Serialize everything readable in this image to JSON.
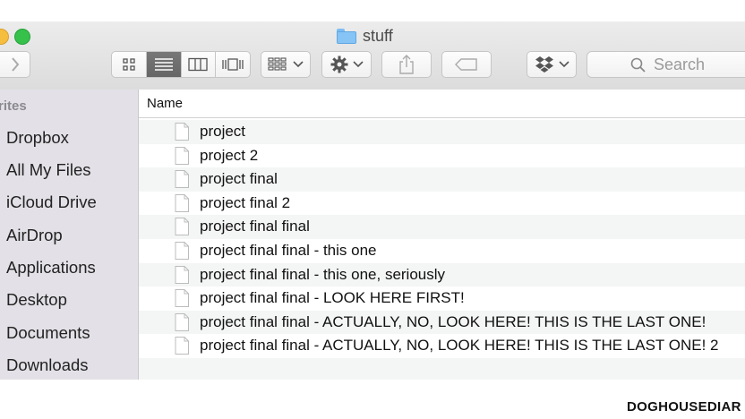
{
  "window": {
    "title": "stuff"
  },
  "toolbar": {
    "search_placeholder": "Search"
  },
  "sidebar": {
    "header": "rites",
    "items": [
      {
        "label": "Dropbox"
      },
      {
        "label": "All My Files"
      },
      {
        "label": "iCloud Drive"
      },
      {
        "label": "AirDrop"
      },
      {
        "label": "Applications"
      },
      {
        "label": "Desktop"
      },
      {
        "label": "Documents"
      },
      {
        "label": "Downloads"
      }
    ]
  },
  "file_list": {
    "column_name": "Name",
    "files": [
      {
        "name": "project"
      },
      {
        "name": "project 2"
      },
      {
        "name": "project final"
      },
      {
        "name": "project final 2"
      },
      {
        "name": "project final final"
      },
      {
        "name": "project final final - this one"
      },
      {
        "name": "project final final - this one, seriously"
      },
      {
        "name": "project final final - LOOK HERE FIRST!"
      },
      {
        "name": "project final final - ACTUALLY, NO, LOOK HERE! THIS IS THE LAST ONE!"
      },
      {
        "name": "project final final - ACTUALLY, NO, LOOK HERE! THIS IS THE LAST ONE! 2"
      }
    ]
  },
  "watermark": "DOGHOUSEDIAR",
  "colors": {
    "folder_blue": "#86c4f5",
    "traffic_yellow": "#f6be3e",
    "traffic_green": "#35c14a",
    "sidebar_bg": "#e3e1e7",
    "active_view": "#6e6e6e"
  }
}
